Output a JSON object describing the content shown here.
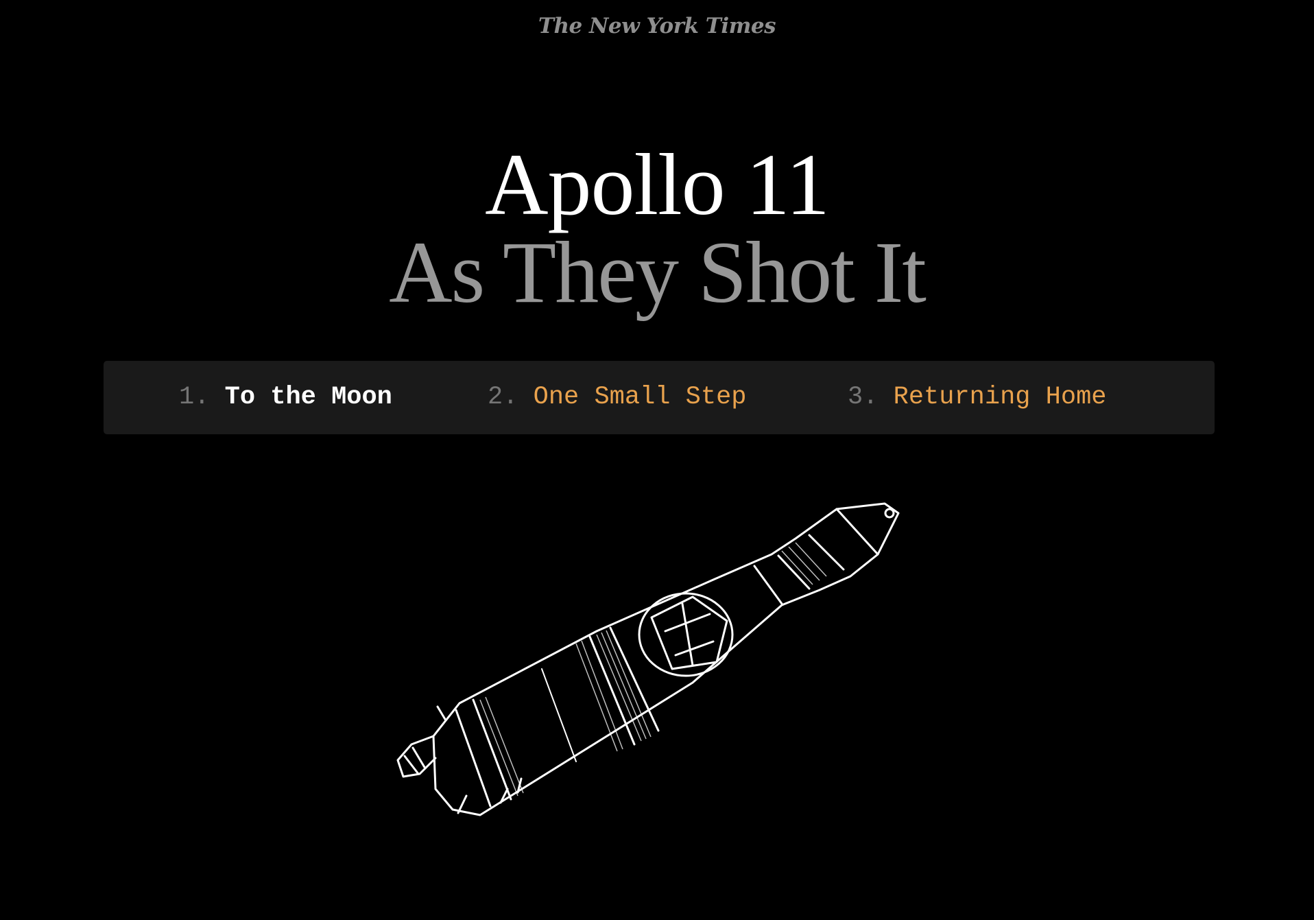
{
  "masthead": {
    "logo_text": "The New York Times"
  },
  "hero": {
    "title": "Apollo 11",
    "subtitle": "As They Shot It"
  },
  "chapters": [
    {
      "number": "1.",
      "label": "To the Moon",
      "active": true
    },
    {
      "number": "2.",
      "label": "One Small Step",
      "active": false
    },
    {
      "number": "3.",
      "label": "Returning Home",
      "active": false
    }
  ],
  "colors": {
    "background": "#000000",
    "nav_background": "#1a1a1a",
    "link_accent": "#e9a24d",
    "subtitle_gray": "#979797"
  },
  "illustration": {
    "icon": "saturn-v-rocket-line-drawing"
  }
}
